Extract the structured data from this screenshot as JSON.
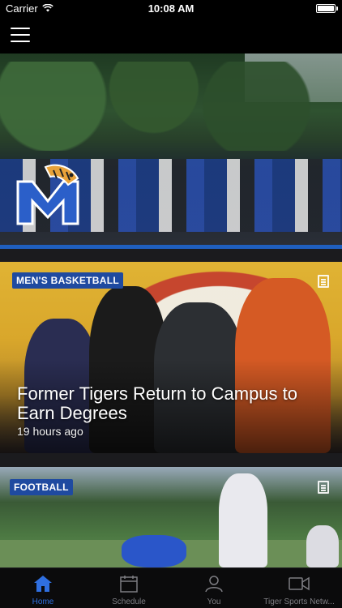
{
  "status_bar": {
    "carrier": "Carrier",
    "time": "10:08 AM"
  },
  "nav": {
    "menu_icon": "hamburger-menu-icon"
  },
  "hero": {
    "logo_icon": "memphis-tigers-logo",
    "accent_color": "#1f5fbf"
  },
  "feed": [
    {
      "category": "MEN'S BASKETBALL",
      "title": "Former Tigers Return to Campus to Earn Degrees",
      "time_ago": "19 hours ago",
      "type_icon": "article-icon"
    },
    {
      "category": "FOOTBALL",
      "type_icon": "article-icon"
    }
  ],
  "tab_bar": {
    "active_color": "#2f6fe0",
    "tabs": [
      {
        "label": "Home",
        "icon": "home-icon",
        "active": true
      },
      {
        "label": "Schedule",
        "icon": "calendar-icon",
        "active": false
      },
      {
        "label": "You",
        "icon": "person-icon",
        "active": false
      },
      {
        "label": "Tiger Sports Netw...",
        "icon": "video-camera-icon",
        "active": false
      }
    ]
  }
}
